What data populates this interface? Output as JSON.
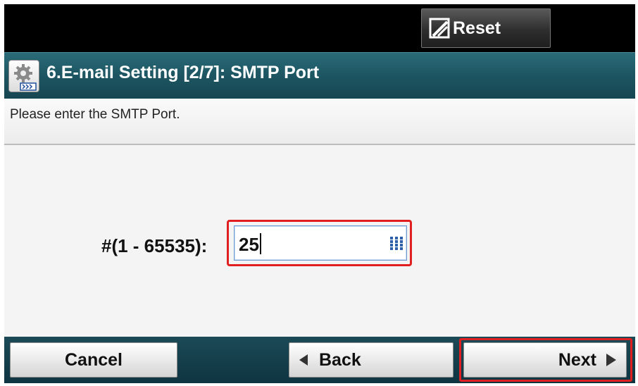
{
  "topbar": {
    "reset_label": "Reset"
  },
  "titlebar": {
    "title": "6.E-mail Setting [2/7]: SMTP Port",
    "icon": "settings-gear-icon"
  },
  "message": {
    "text": "Please enter the SMTP Port."
  },
  "form": {
    "label": "#(1 - 65535):",
    "value": "25",
    "keypad_icon": "keypad-icon"
  },
  "footer": {
    "cancel_label": "Cancel",
    "back_label": "Back",
    "next_label": "Next"
  },
  "colors": {
    "titlebar": "#1d5562",
    "highlight": "#e02020",
    "topbar": "#000000"
  }
}
